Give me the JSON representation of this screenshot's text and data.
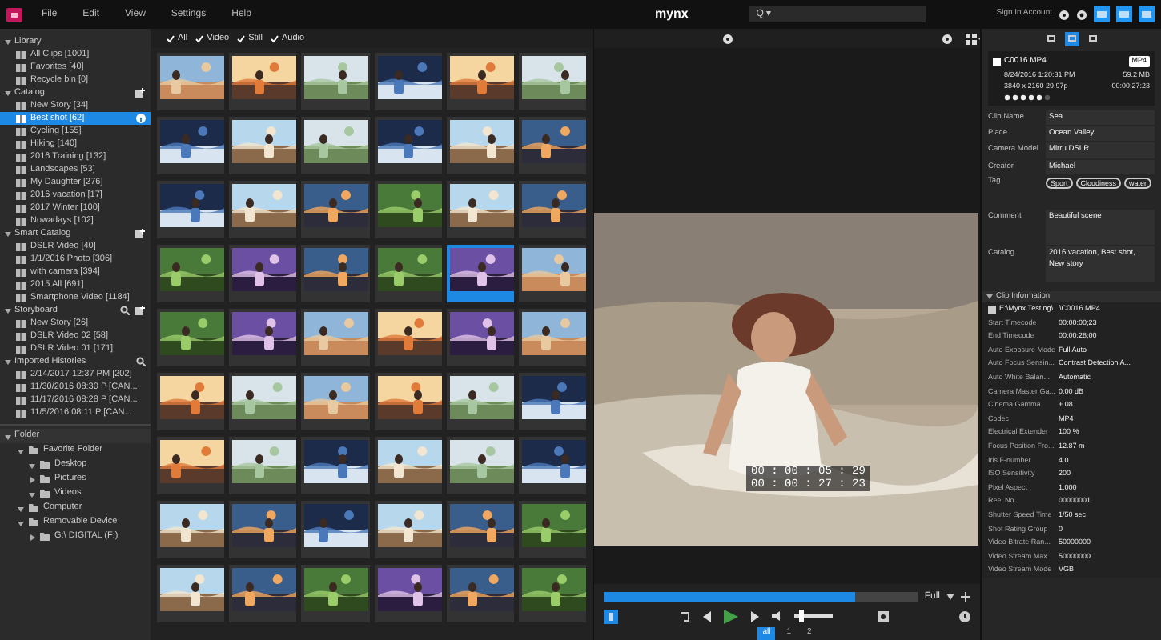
{
  "menu": {
    "items": [
      "File",
      "Edit",
      "View",
      "Settings",
      "Help"
    ],
    "title": "mynx",
    "search": {
      "placeholder": "Q ▾"
    },
    "account": "Sign In Account"
  },
  "sidebar": {
    "sections": [
      {
        "label": "Library",
        "kind": "library",
        "expanded": true,
        "items": [
          {
            "label": "All Clips [1001]",
            "selected": false
          },
          {
            "label": "Favorites [40]",
            "selected": false
          },
          {
            "label": "Recycle bin [0]",
            "selected": false
          }
        ]
      },
      {
        "label": "Catalog",
        "kind": "catalog",
        "expanded": true,
        "items": [
          {
            "label": "New Story [34]",
            "selected": false
          },
          {
            "label": "Best shot [62]",
            "selected": true
          },
          {
            "label": "Cycling [155]",
            "selected": false
          },
          {
            "label": "Hiking [140]",
            "selected": false
          },
          {
            "label": "2016 Training [132]",
            "selected": false
          },
          {
            "label": "Landscapes [53]",
            "selected": false
          },
          {
            "label": "My Daughter [276]",
            "selected": false
          },
          {
            "label": "2016 vacation [17]",
            "selected": false
          },
          {
            "label": "2017 Winter [100]",
            "selected": false
          },
          {
            "label": "Nowadays [102]",
            "selected": false
          }
        ]
      },
      {
        "label": "Smart Catalog",
        "kind": "catalog",
        "expanded": true,
        "items": [
          {
            "label": "DSLR Video [40]",
            "selected": false
          },
          {
            "label": "1/1/2016 Photo [306]",
            "selected": false
          },
          {
            "label": "with camera [394]",
            "selected": false
          },
          {
            "label": "2015 All [691]",
            "selected": false
          },
          {
            "label": "Smartphone Video [1184]",
            "selected": false
          }
        ]
      },
      {
        "label": "Storyboard",
        "kind": "storyboard",
        "expanded": true,
        "items": [
          {
            "label": "New Story [26]",
            "selected": false
          },
          {
            "label": "DSLR Video 02 [58]",
            "selected": false
          },
          {
            "label": "DSLR Video 01 [171]",
            "selected": false
          }
        ]
      },
      {
        "label": "Imported Histories",
        "kind": "history",
        "expanded": true,
        "items": [
          {
            "label": "2/14/2017 12:37 PM [202]",
            "selected": false
          },
          {
            "label": "11/30/2016 08:30 P [CAN...",
            "selected": false
          },
          {
            "label": "11/17/2016 08:28 P [CAN...",
            "selected": false
          },
          {
            "label": "11/5/2016 08:11 P [CAN...",
            "selected": false
          }
        ]
      }
    ]
  },
  "folders": {
    "label": "Folder",
    "expanded": true,
    "items": [
      {
        "label": "Favorite Folder",
        "expanded": true,
        "children": [
          {
            "label": "Desktop",
            "expanded": true
          },
          {
            "label": "Pictures",
            "expanded": false
          },
          {
            "label": "Videos",
            "expanded": true
          }
        ]
      },
      {
        "label": "Computer",
        "expanded": true
      },
      {
        "label": "Removable Device",
        "expanded": true,
        "children": [
          {
            "label": "G:\\ DIGITAL (F:)",
            "expanded": false
          }
        ]
      }
    ]
  },
  "filters": [
    {
      "label": "All",
      "checked": true
    },
    {
      "label": "Video",
      "checked": true
    },
    {
      "label": "Still",
      "checked": true
    },
    {
      "label": "Audio",
      "checked": true
    }
  ],
  "thumbnails": [
    {
      "selected": false
    },
    {
      "selected": false
    },
    {
      "selected": false
    },
    {
      "selected": false
    },
    {
      "selected": false
    },
    {
      "selected": false
    },
    {
      "selected": false
    },
    {
      "selected": false
    },
    {
      "selected": false
    },
    {
      "selected": false
    },
    {
      "selected": false
    },
    {
      "selected": false
    },
    {
      "selected": false
    },
    {
      "selected": false
    },
    {
      "selected": false
    },
    {
      "selected": false
    },
    {
      "selected": false
    },
    {
      "selected": false
    },
    {
      "selected": false
    },
    {
      "selected": false
    },
    {
      "selected": false
    },
    {
      "selected": false
    },
    {
      "selected": true
    },
    {
      "selected": false
    },
    {
      "selected": false
    },
    {
      "selected": false
    },
    {
      "selected": false
    },
    {
      "selected": false
    },
    {
      "selected": false
    },
    {
      "selected": false
    },
    {
      "selected": false
    },
    {
      "selected": false
    },
    {
      "selected": false
    },
    {
      "selected": false
    },
    {
      "selected": false
    },
    {
      "selected": false
    },
    {
      "selected": false
    },
    {
      "selected": false
    },
    {
      "selected": false
    },
    {
      "selected": false
    },
    {
      "selected": false
    },
    {
      "selected": false
    },
    {
      "selected": false
    },
    {
      "selected": false
    },
    {
      "selected": false
    },
    {
      "selected": false
    },
    {
      "selected": false
    },
    {
      "selected": false
    },
    {
      "selected": false
    },
    {
      "selected": false
    },
    {
      "selected": false
    },
    {
      "selected": false
    },
    {
      "selected": false
    },
    {
      "selected": false
    }
  ],
  "preview": {
    "timecodes": [
      "00 : 00 : 05 : 29",
      "00 : 00 : 27 : 23"
    ],
    "progress": {
      "level": 0.8
    },
    "zoom": "Full",
    "volume": {
      "level": 0.2
    },
    "pages": [
      {
        "label": "all",
        "selected": true
      },
      {
        "label": "1",
        "selected": false
      },
      {
        "label": "2",
        "selected": false
      }
    ]
  },
  "inspector": {
    "tabs": [
      {
        "selected": false
      },
      {
        "selected": true
      },
      {
        "selected": false
      }
    ],
    "clip": {
      "name": "C0016.MP4",
      "format": "MP4",
      "date": "8/24/2016 1:20:31 PM",
      "size": "59.2 MB",
      "resolution": "3840 x 2160 29.97p",
      "duration": "00:00:27:23",
      "stars": 5
    },
    "fields": [
      {
        "label": "Clip Name",
        "value": "Sea"
      },
      {
        "label": "Place",
        "value": "Ocean Valley"
      },
      {
        "label": "Camera Model",
        "value": "Mirru DSLR"
      },
      {
        "label": "Creator",
        "value": "Michael"
      }
    ],
    "tag": {
      "label": "Tag",
      "tags": [
        "Sport",
        "Cloudiness",
        "water"
      ]
    },
    "comment": {
      "label": "Comment",
      "value": "Beautiful scene"
    },
    "catalog": {
      "label": "Catalog",
      "value": "2016 vacation, Best shot, New story"
    },
    "clip_info": {
      "title": "Clip Information",
      "path": "E:\\Mynx Testing\\...\\C0016.MP4",
      "rows": [
        [
          "Start Timecode",
          "00:00:00;23"
        ],
        [
          "End Timecode",
          "00:00:28;00"
        ],
        [
          "Auto Exposure Mode",
          "Full Auto"
        ],
        [
          "Auto Focus Sensin...",
          "Contrast Detection A..."
        ],
        [
          "Auto White Balan...",
          "Automatic"
        ],
        [
          "Camera Master Ga...",
          "0.00 dB"
        ],
        [
          "Cinema Gamma",
          "+.08"
        ],
        [
          "Codec",
          "MP4"
        ],
        [
          "Electrical Extender",
          "100 %"
        ],
        [
          "Focus Position Fro...",
          "12.87 m"
        ],
        [
          "Iris F-number",
          "4.0"
        ],
        [
          "ISO Sensitivity",
          "200"
        ],
        [
          "Pixel Aspect",
          "1.000"
        ],
        [
          "Reel No.",
          "00000001"
        ],
        [
          "Shutter Speed Time",
          "1/50 sec"
        ],
        [
          "Shot Rating Group",
          "0"
        ],
        [
          "Video Bitrate Ran...",
          "50000000"
        ],
        [
          "Video Stream Max",
          "50000000"
        ],
        [
          "Video Stream Mode",
          "VGB"
        ]
      ]
    }
  }
}
